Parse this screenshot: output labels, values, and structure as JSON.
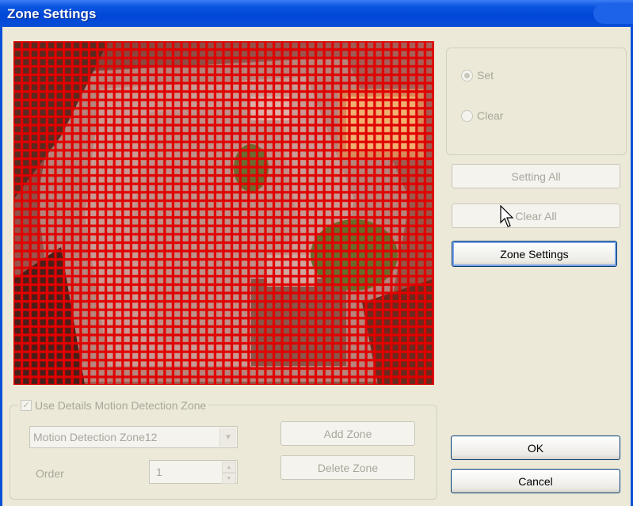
{
  "window": {
    "title": "Zone Settings"
  },
  "mode": {
    "set_label": "Set",
    "clear_label": "Clear",
    "selected": "Set"
  },
  "buttons": {
    "setting_all": "Setting All",
    "clear_all": "Clear All",
    "zone_settings": "Zone Settings",
    "ok": "OK",
    "cancel": "Cancel",
    "add_zone": "Add Zone",
    "delete_zone": "Delete Zone"
  },
  "details": {
    "checkbox_label": "Use Details Motion Detection Zone",
    "checked": true,
    "zone_select_value": "Motion Detection Zone12",
    "order_label": "Order",
    "order_value": "1"
  },
  "icons": {
    "radio_set": "radio-icon",
    "radio_clear": "radio-icon",
    "checkbox": "checkmark-icon",
    "combo_arrow": "chevron-down-icon",
    "spin_up": "chevron-up-icon",
    "spin_down": "chevron-down-icon",
    "cursor": "mouse-pointer-icon"
  },
  "colors": {
    "title_bar": "#0a4fd8",
    "grid_line": "#e00000",
    "dialog_bg": "#ece9d8"
  }
}
